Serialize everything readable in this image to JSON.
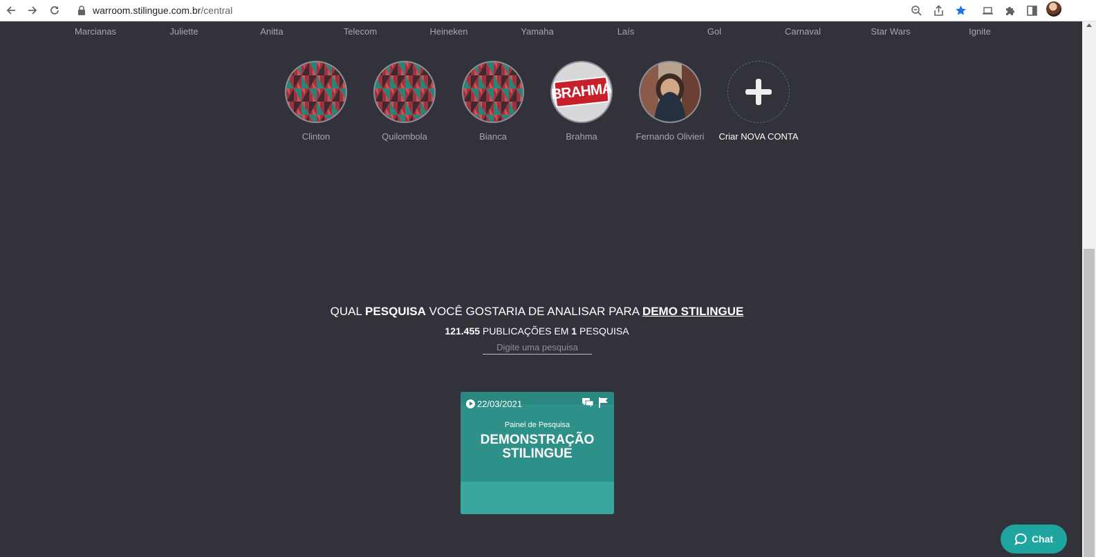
{
  "browser": {
    "url_host": "warroom.stilingue.com.br",
    "url_path": "/central"
  },
  "brands": [
    "Marcianas",
    "Juliette",
    "Anitta",
    "Telecom",
    "Heineken",
    "Yamaha",
    "Laís",
    "Gol",
    "Carnaval",
    "Star Wars",
    "Ignite"
  ],
  "accounts": {
    "items": [
      {
        "label": "Clinton",
        "avatar": "triangle-pattern"
      },
      {
        "label": "Quilombola",
        "avatar": "triangle-pattern"
      },
      {
        "label": "Bianca",
        "avatar": "triangle-pattern"
      },
      {
        "label": "Brahma",
        "avatar": "brahma-logo",
        "logo_text": "BRAHMA"
      },
      {
        "label": "Fernando Olivieri",
        "avatar": "user-photo"
      }
    ],
    "new_account_label": "Criar NOVA CONTA"
  },
  "search_section": {
    "question_prefix": "QUAL ",
    "question_bold": "PESQUISA",
    "question_middle": " VOCÊ GOSTARIA DE ANALISAR PARA ",
    "question_account": "DEMO STILINGUE",
    "publications_count": "121.455",
    "publications_label": " PUBLICAÇÕES EM ",
    "search_count": "1",
    "search_label": " PESQUISA",
    "input_placeholder": "Digite uma pesquisa"
  },
  "card": {
    "date": "22/03/2021",
    "subtitle": "Painel de Pesquisa",
    "title_line1": "DEMONSTRAÇÃO",
    "title_line2": "STILINGUE"
  },
  "chat": {
    "label": "Chat",
    "color": "#1fa5a0"
  },
  "colors": {
    "background": "#31323a",
    "card": "#2e9189"
  }
}
